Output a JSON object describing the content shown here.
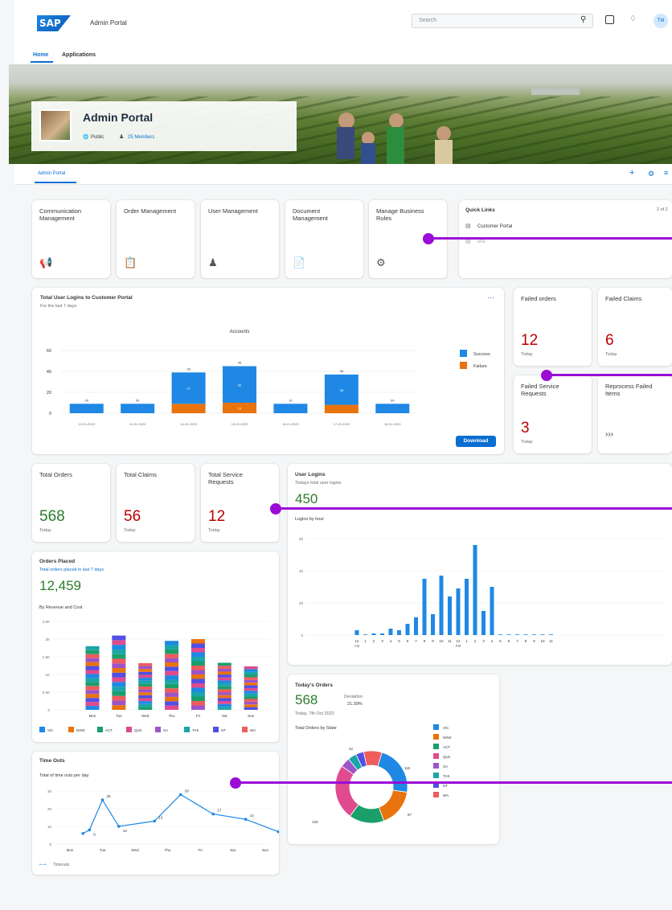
{
  "header": {
    "logo": "SAP",
    "app_title": "Admin Portal",
    "search_placeholder": "Search",
    "avatar_initials": "TM"
  },
  "nav": {
    "tabs": [
      "Home",
      "Applications"
    ]
  },
  "banner": {
    "title": "Admin Portal",
    "visibility": "Public",
    "members": "25 Members"
  },
  "subnav": {
    "active_tab": "Admin Portal"
  },
  "tiles": [
    {
      "label": "Communication Management",
      "icon": "megaphone-icon"
    },
    {
      "label": "Order Management",
      "icon": "clipboard-icon"
    },
    {
      "label": "User Management",
      "icon": "user-settings-icon"
    },
    {
      "label": "Document Management",
      "icon": "document-icon"
    },
    {
      "label": "Manage Business Rules",
      "icon": "gears-icon"
    }
  ],
  "quick_links": {
    "title": "Quick Links",
    "pager": "2 of 2",
    "items": [
      "Customer Portal",
      "IAS"
    ]
  },
  "logins_chart": {
    "title": "Total User Logins to Customer Portal",
    "subtitle": "For the last 7 days",
    "more": "…",
    "download": "Download"
  },
  "kpi_failed": [
    {
      "label": "Failed orders",
      "value": "12",
      "sub": "Today",
      "color": "#bb0000"
    },
    {
      "label": "Failed Claims",
      "value": "6",
      "sub": "Today",
      "color": "#bb0000"
    },
    {
      "label": "Failed Service Requests",
      "value": "3",
      "sub": "Today",
      "color": "#bb0000"
    },
    {
      "label": "Reprocess Failed Items",
      "value": "›››",
      "sub": "",
      "color": "#32363a"
    }
  ],
  "kpi_totals": [
    {
      "label": "Total Orders",
      "value": "568",
      "sub": "Today",
      "color": "#2b7c2b"
    },
    {
      "label": "Total Claims",
      "value": "56",
      "sub": "Today",
      "color": "#bb0000"
    },
    {
      "label": "Total Service Requests",
      "value": "12",
      "sub": "Today",
      "color": "#bb0000"
    }
  ],
  "user_logins": {
    "title": "User Logins",
    "subtitle": "Todays total user logins",
    "value": "450",
    "chart_label": "Logins by hour"
  },
  "orders_placed": {
    "title": "Orders Placed",
    "subtitle": "Total orders placed in last 7 days",
    "value": "12,459",
    "chart_label": "By Revenue and Cost"
  },
  "todays_orders": {
    "title": "Today's Orders",
    "value": "568",
    "deviation_label": "Deviation",
    "deviation": "21.39%",
    "date": "Today, 7th Oct 2022",
    "chart_label": "Total Orders by State"
  },
  "time_outs": {
    "title": "Time Outs",
    "subtitle": "Total of time outs per day",
    "legend": "Timeouts"
  },
  "chart_data": [
    {
      "type": "bar",
      "title": "Accounts",
      "categories": [
        "12-01-2023",
        "13-01-2023",
        "14-01-2023",
        "15-01-2023",
        "16-01-2023",
        "17-01-2023",
        "18-01-2023"
      ],
      "series": [
        {
          "name": "Success",
          "values": [
            9,
            9,
            30,
            35,
            9,
            29,
            9
          ],
          "color": "#1f88e5"
        },
        {
          "name": "Failure",
          "values": [
            0,
            0,
            9,
            10,
            0,
            8,
            0
          ],
          "color": "#e9730c"
        }
      ],
      "total_labels": [
        "09",
        "09",
        "39",
        "45",
        "10",
        "36",
        "09"
      ],
      "inner_labels": [
        "",
        "",
        "27",
        "30",
        "",
        "28",
        ""
      ],
      "failure_labels": [
        "",
        "",
        "",
        "15",
        "",
        "",
        ""
      ],
      "ylim": [
        0,
        60
      ],
      "yticks": [
        0,
        20,
        40,
        60
      ],
      "legend_position": "right"
    },
    {
      "type": "bar",
      "title": "",
      "categories": [
        "12\nAM",
        "1",
        "2",
        "3",
        "4",
        "5",
        "6",
        "7",
        "8",
        "9",
        "10",
        "11",
        "12\nPM",
        "1",
        "2",
        "3",
        "4",
        "5",
        "6",
        "7",
        "8",
        "9",
        "10",
        "11"
      ],
      "values": [
        3,
        0,
        1,
        1,
        4,
        3,
        7,
        11,
        35,
        13,
        37,
        24,
        29,
        35,
        56,
        15,
        30,
        0,
        0,
        0,
        0,
        0,
        0,
        0
      ],
      "ylim": [
        0,
        60
      ],
      "yticks": [
        0,
        20,
        40,
        60
      ],
      "color": "#1f88e5"
    },
    {
      "type": "bar",
      "title": "",
      "stacked": true,
      "categories": [
        "Mon",
        "Tue",
        "Wed",
        "Thu",
        "Fri",
        "Sat",
        "Sun"
      ],
      "totals": [
        1800,
        2100,
        1320,
        1950,
        2000,
        1330,
        1230
      ],
      "series": [
        {
          "name": "VIC",
          "color": "#1f88e5"
        },
        {
          "name": "NSW",
          "color": "#e9730c"
        },
        {
          "name": "ACT",
          "color": "#1a9f6a"
        },
        {
          "name": "QLD",
          "color": "#df4b8e"
        },
        {
          "name": "SA",
          "color": "#9c55c7"
        },
        {
          "name": "TAS",
          "color": "#1aa5a9"
        },
        {
          "name": "NT",
          "color": "#5050e6"
        },
        {
          "name": "WA",
          "color": "#ee5c5c"
        }
      ],
      "ylim": [
        0,
        2500
      ],
      "yticks": [
        "0",
        "0.5K",
        "1K",
        "1.5K",
        "2K",
        "2.5K"
      ]
    },
    {
      "type": "pie",
      "title": "Total Orders by State",
      "donut": true,
      "slices": [
        {
          "name": "VIC",
          "value": 115,
          "color": "#1f88e5"
        },
        {
          "name": "NSW",
          "value": 87,
          "color": "#e9730c"
        },
        {
          "name": "ACT",
          "value": 80,
          "color": "#1a9f6a"
        },
        {
          "name": "QLD",
          "value": 126,
          "color": "#df4b8e"
        },
        {
          "name": "SA",
          "value": 22,
          "color": "#9c55c7"
        },
        {
          "name": "TAS",
          "value": 20,
          "color": "#1aa5a9"
        },
        {
          "name": "NT",
          "value": 18,
          "color": "#5050e6"
        },
        {
          "name": "WA",
          "value": 42,
          "color": "#ee5c5c"
        }
      ],
      "data_labels": [
        "115",
        "87",
        "126",
        "42"
      ]
    },
    {
      "type": "line",
      "title": "",
      "categories": [
        "Mon",
        "Tue",
        "Wed",
        "Thu",
        "Fri",
        "Sat",
        "Sun"
      ],
      "points": [
        6,
        8,
        25,
        10,
        13,
        28,
        17,
        14,
        7
      ],
      "x_positions": [
        0.4,
        0.6,
        1,
        1.5,
        2.6,
        3.4,
        4.4,
        5.4,
        6.4
      ],
      "point_labels": [
        "",
        "8",
        "25",
        "10",
        "13",
        "28",
        "17",
        "14",
        "7"
      ],
      "ylim": [
        0,
        30
      ],
      "yticks": [
        0,
        10,
        20,
        30
      ],
      "series_name": "Timeouts",
      "color": "#1f88e5"
    }
  ]
}
